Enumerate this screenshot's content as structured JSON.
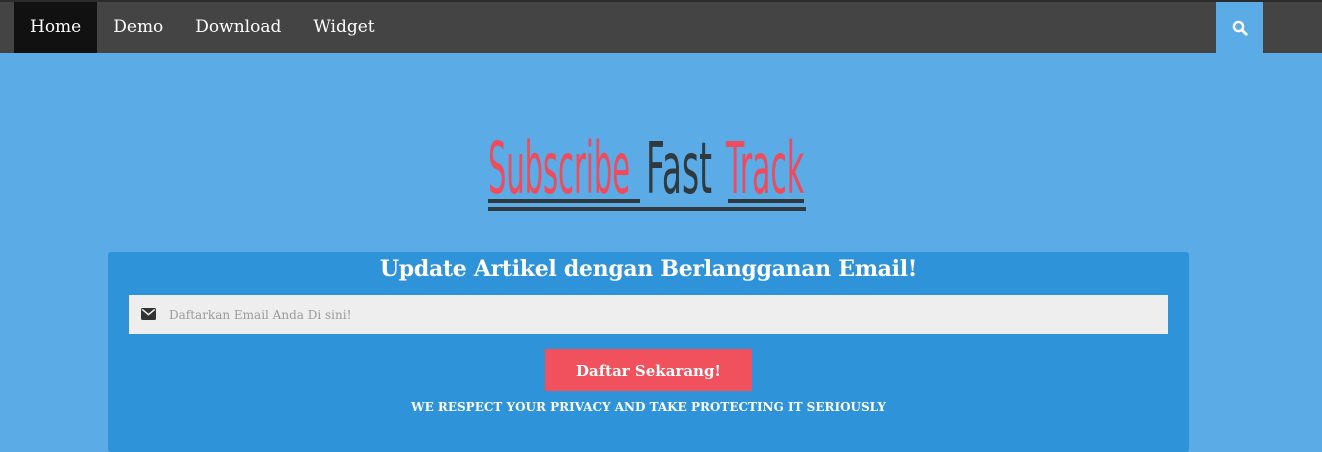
{
  "nav": {
    "items": [
      {
        "label": "Home",
        "active": true
      },
      {
        "label": "Demo",
        "active": false
      },
      {
        "label": "Download",
        "active": false
      },
      {
        "label": "Widget",
        "active": false
      }
    ],
    "search_icon": "search-icon"
  },
  "logo": {
    "word1": "Subscribe",
    "word2": "Fast",
    "word3": "Track",
    "colors": {
      "red": "#ef4b5b",
      "dark": "#2f3a3f"
    }
  },
  "subscribe": {
    "title": "Update Artikel dengan Berlangganan Email!",
    "email_placeholder": "Daftarkan Email Anda Di sini!",
    "email_value": "",
    "button_label": "Daftar Sekarang!",
    "privacy_text": "WE RESPECT YOUR PRIVACY AND TAKE PROTECTING IT SERIOUSLY",
    "mail_icon": "envelope-icon"
  },
  "colors": {
    "page_bg": "#5aabe6",
    "topbar_bg": "#444444",
    "card_bg": "#2e93d9",
    "button_bg": "#f0515c"
  }
}
